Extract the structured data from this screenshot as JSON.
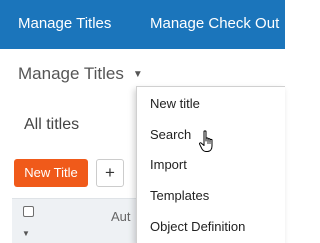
{
  "topnav": {
    "items": [
      "Manage Titles",
      "Manage Check Out"
    ]
  },
  "page": {
    "heading": "Manage Titles",
    "section_title": "All titles"
  },
  "toolbar": {
    "new_title_label": "New Title",
    "add_label": "+"
  },
  "table": {
    "col_author_partial": "Aut"
  },
  "dropdown": {
    "items": [
      "New title",
      "Search",
      "Import",
      "Templates",
      "Object Definition"
    ]
  },
  "colors": {
    "nav_bg": "#1b75bb",
    "primary_button": "#f05a1a"
  }
}
